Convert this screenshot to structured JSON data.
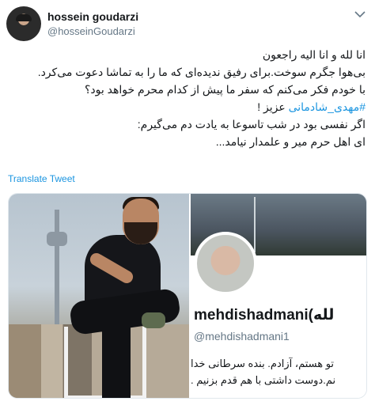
{
  "author": {
    "display_name": "hossein goudarzi",
    "handle": "@hosseinGoudarzi"
  },
  "tweet": {
    "lines": [
      "انا لله و انا الیه راجعون",
      "بی‌هوا جگرم سوخت.برای رفیق ندیده‌ای که ما را به تماشا دعوت می‌کرد.",
      "با خودم فکر می‌کنم که سفر ما پیش از کدام محرم خواهد بود؟",
      "#مهدی_شادمانی عزیز !",
      "اگر نفسی بود در شب تاسوعا به یادت دم می‌گیرم:",
      "ای اهل حرم میر و علمدار نیامد..."
    ],
    "hashtag": "#مهدی_شادمانی",
    "hashtag_suffix": " عزیز !",
    "translate_label": "Translate Tweet"
  },
  "media": {
    "screenshot": {
      "name": "mehdishadmani(لله",
      "handle": "@mehdishadmani1",
      "bio_lines": [
        "تو هستم، آزادم. بنده سرطانی خدا",
        "نم.دوست داشتی با هم قدم بزنیم ."
      ]
    }
  },
  "colors": {
    "link": "#1b95e0",
    "text": "#14171a",
    "secondary": "#657786"
  }
}
